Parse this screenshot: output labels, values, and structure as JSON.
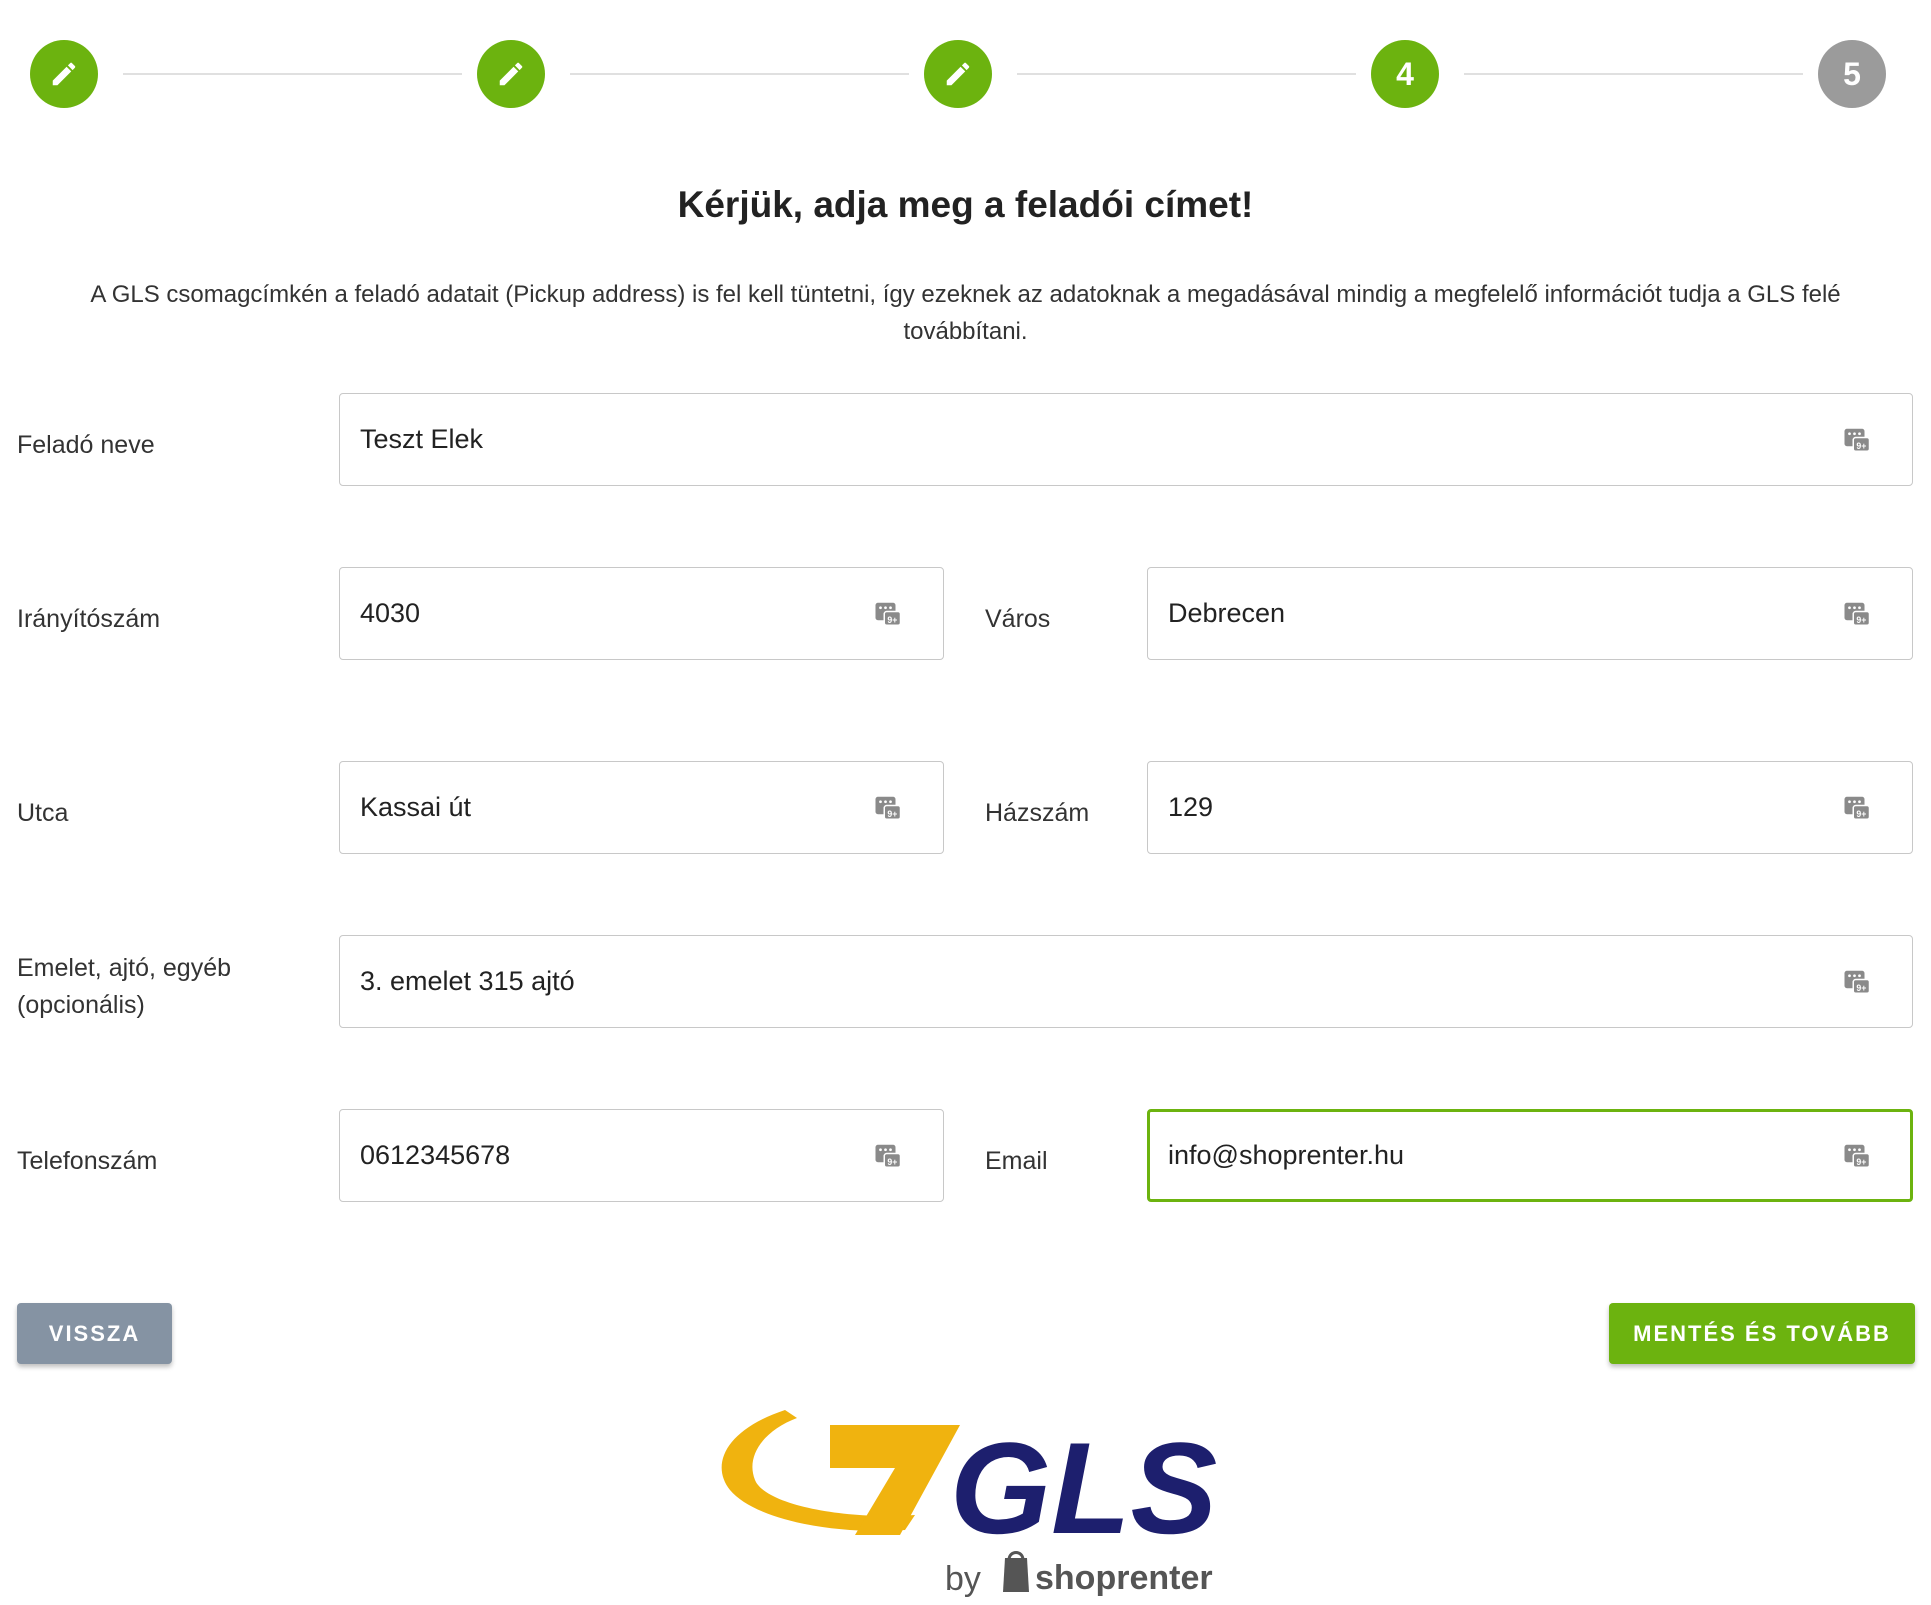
{
  "stepper": {
    "steps": [
      {
        "state": "done",
        "label": "",
        "icon": "pencil-icon"
      },
      {
        "state": "done",
        "label": "",
        "icon": "pencil-icon"
      },
      {
        "state": "done",
        "label": "",
        "icon": "pencil-icon"
      },
      {
        "state": "active",
        "label": "4"
      },
      {
        "state": "pending",
        "label": "5"
      }
    ],
    "colors": {
      "done": "#6cb30f",
      "pending": "#9b9b9b"
    }
  },
  "page": {
    "title": "Kérjük, adja meg a feladói címet!",
    "description": "A GLS csomagcímkén a feladó adatait (Pickup address) is fel kell tüntetni, így ezeknek az adatoknak a megadásával mindig a megfelelő információt tudja a GLS felé továbbítani."
  },
  "form": {
    "sender_name": {
      "label": "Feladó neve",
      "value": "Teszt Elek"
    },
    "zip": {
      "label": "Irányítószám",
      "value": "4030"
    },
    "city": {
      "label": "Város",
      "value": "Debrecen"
    },
    "street": {
      "label": "Utca",
      "value": "Kassai út"
    },
    "house_number": {
      "label": "Házszám",
      "value": "129"
    },
    "extra": {
      "label_line1": "Emelet, ajtó, egyéb",
      "label_line2": "(opcionális)",
      "value": "3. emelet 315 ajtó"
    },
    "phone": {
      "label": "Telefonszám",
      "value": "0612345678"
    },
    "email": {
      "label": "Email",
      "value": "info@shoprenter.hu"
    }
  },
  "buttons": {
    "back": "VISSZA",
    "next": "MENTÉS ÉS TOVÁBB"
  },
  "logo": {
    "brand": "GLS",
    "by": "by",
    "partner": "shoprenter"
  },
  "colors": {
    "accent": "#6cb30f",
    "back_button": "#8593a3",
    "gls_blue": "#1d1f6e",
    "gls_yellow": "#f0b30f"
  }
}
